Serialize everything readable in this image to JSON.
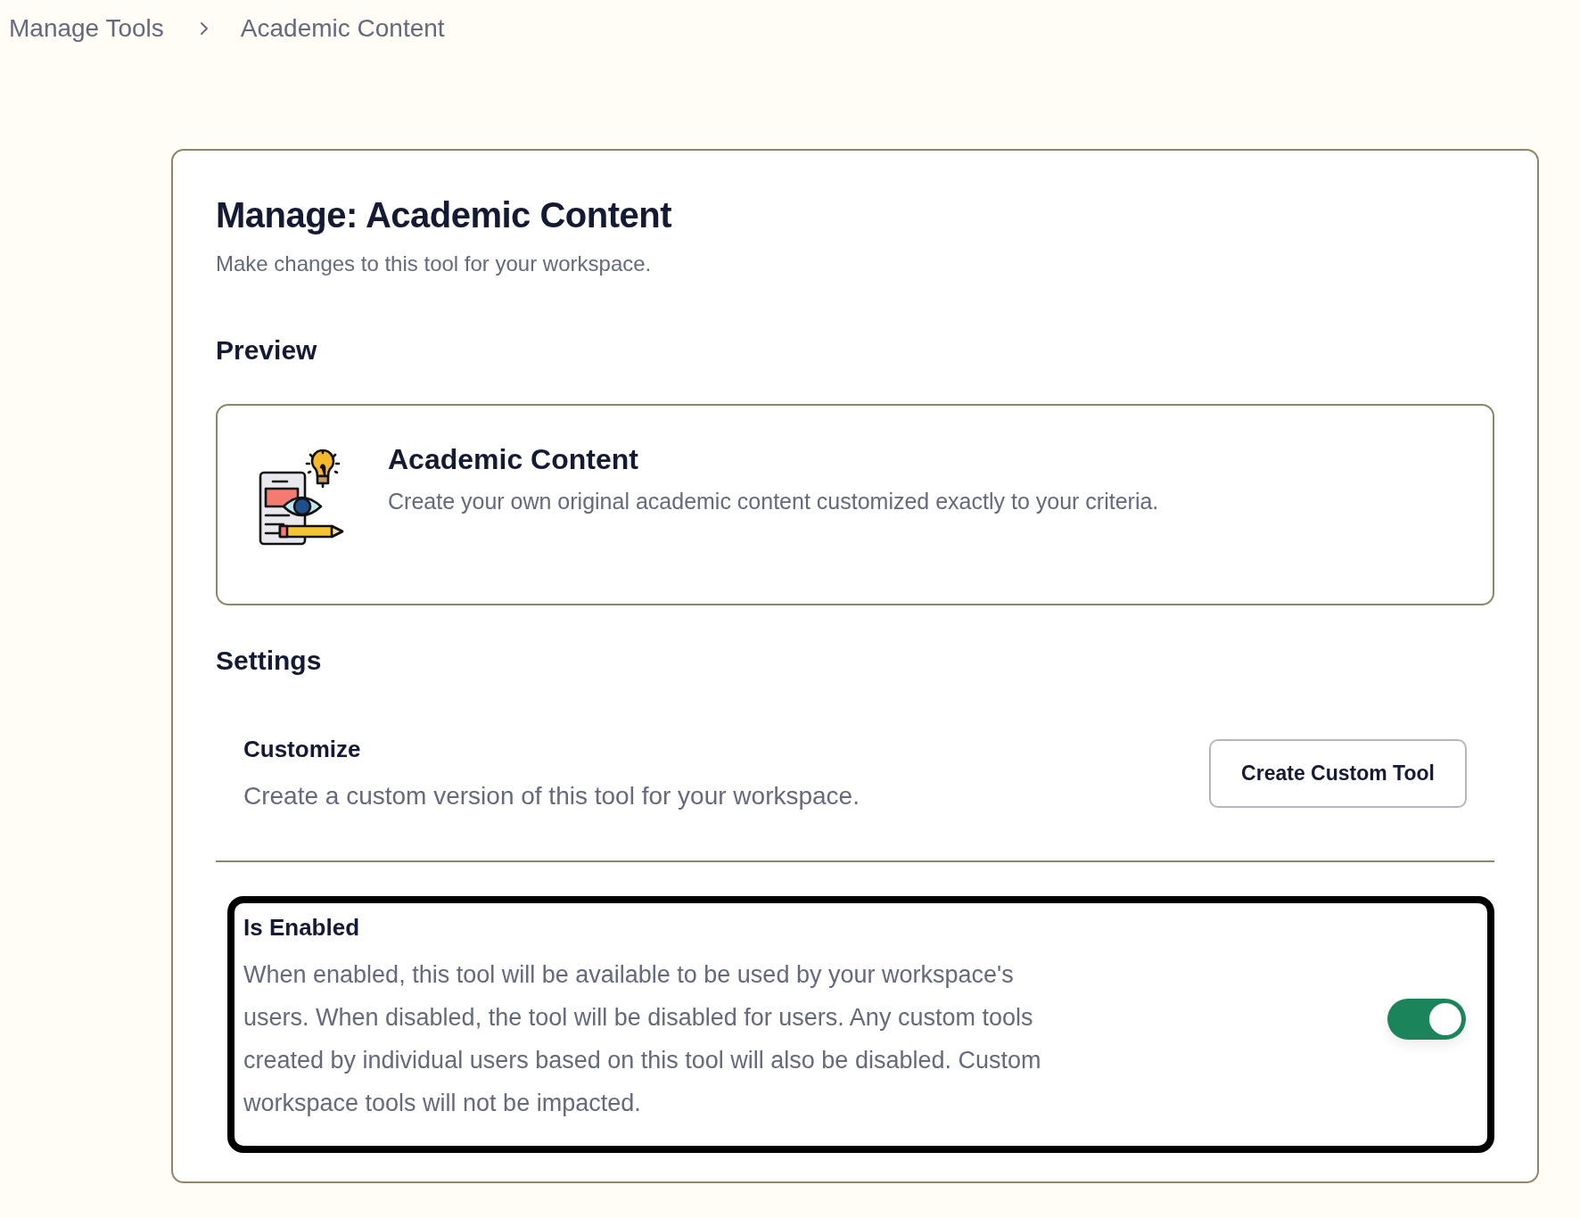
{
  "breadcrumb": [
    {
      "label": "Manage Tools"
    },
    {
      "label": "Academic Content"
    }
  ],
  "page": {
    "title": "Manage: Academic Content",
    "subtitle": "Make changes to this tool for your workspace."
  },
  "preview": {
    "heading": "Preview",
    "tool": {
      "name": "Academic Content",
      "description": "Create your own original academic content customized exactly to your criteria."
    }
  },
  "settings": {
    "heading": "Settings",
    "items": [
      {
        "kind": "action",
        "title": "Customize",
        "description": "Create a custom version of this tool for your workspace.",
        "button": "Create Custom Tool"
      },
      {
        "kind": "toggle",
        "title": "Is Enabled",
        "description": "When enabled, this tool will be available to be used by your workspace's users. When disabled, the tool will be disabled for users. Any custom tools created by individual users based on this tool will also be disabled. Custom workspace tools will not be impacted.",
        "on": true,
        "focused": true
      }
    ]
  }
}
